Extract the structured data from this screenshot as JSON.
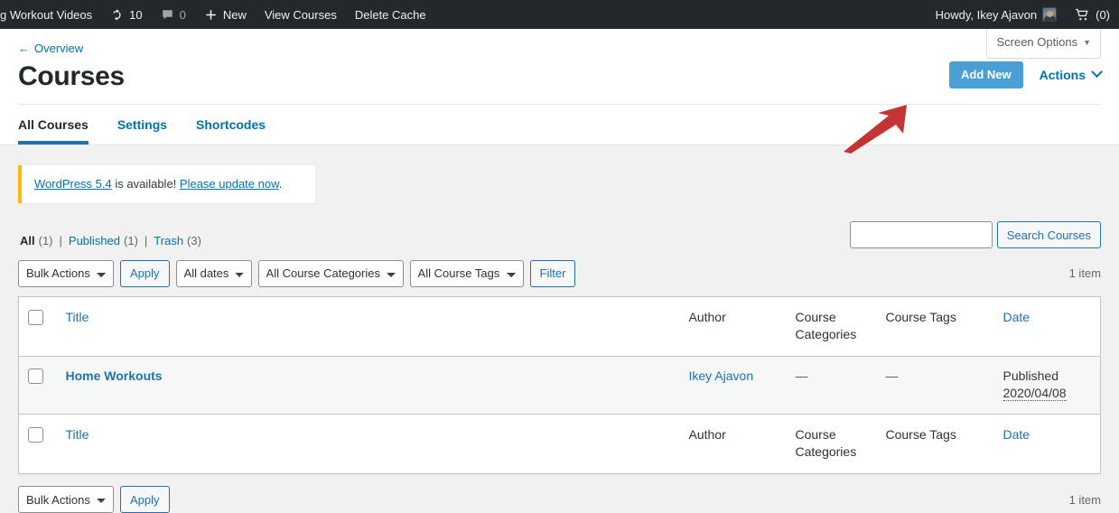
{
  "adminbar": {
    "site_name": "g Workout Videos",
    "updates_icon": "updates-icon",
    "updates_count": "10",
    "comments_icon": "comment-bubble-icon",
    "comments_count": "0",
    "new_icon": "plus-icon",
    "new_label": "New",
    "view_courses_label": "View Courses",
    "delete_cache_label": "Delete Cache",
    "howdy": "Howdy, Ikey Ajavon",
    "cart_icon": "cart-icon",
    "cart_count": "(0)"
  },
  "header": {
    "overview_link": "Overview",
    "back_arrow": "←",
    "page_title": "Courses",
    "screen_options_label": "Screen Options",
    "add_new_label": "Add New",
    "actions_label": "Actions",
    "add_new_color": "#4a9fd5",
    "annotation_arrow_color": "#c33434"
  },
  "tabs": [
    {
      "label": "All Courses",
      "active": true
    },
    {
      "label": "Settings",
      "active": false
    },
    {
      "label": "Shortcodes",
      "active": false
    }
  ],
  "notice": {
    "link_version": "WordPress 5.4",
    "middle_text": " is available! ",
    "link_update": "Please update now",
    "trailing": ".",
    "accent_color": "#ffb900"
  },
  "status_links": {
    "all_label": "All",
    "all_count": "(1)",
    "published_label": "Published",
    "published_count": "(1)",
    "trash_label": "Trash",
    "trash_count": "(3)",
    "separator": "|"
  },
  "search": {
    "value": "",
    "placeholder": "",
    "button_label": "Search Courses"
  },
  "tablenav_top": {
    "bulk_actions": "Bulk Actions",
    "apply_label": "Apply",
    "dates": "All dates",
    "categories": "All Course Categories",
    "tags": "All Course Tags",
    "filter_label": "Filter",
    "item_count": "1 item"
  },
  "tablenav_bottom": {
    "bulk_actions": "Bulk Actions",
    "apply_label": "Apply",
    "item_count": "1 item"
  },
  "table": {
    "columns": {
      "title": "Title",
      "author": "Author",
      "categories": "Course Categories",
      "tags": "Course Tags",
      "date": "Date"
    },
    "rows": [
      {
        "title": "Home Workouts",
        "author": "Ikey Ajavon",
        "categories": "—",
        "tags": "—",
        "date_status": "Published",
        "date_value": "2020/04/08"
      }
    ]
  }
}
